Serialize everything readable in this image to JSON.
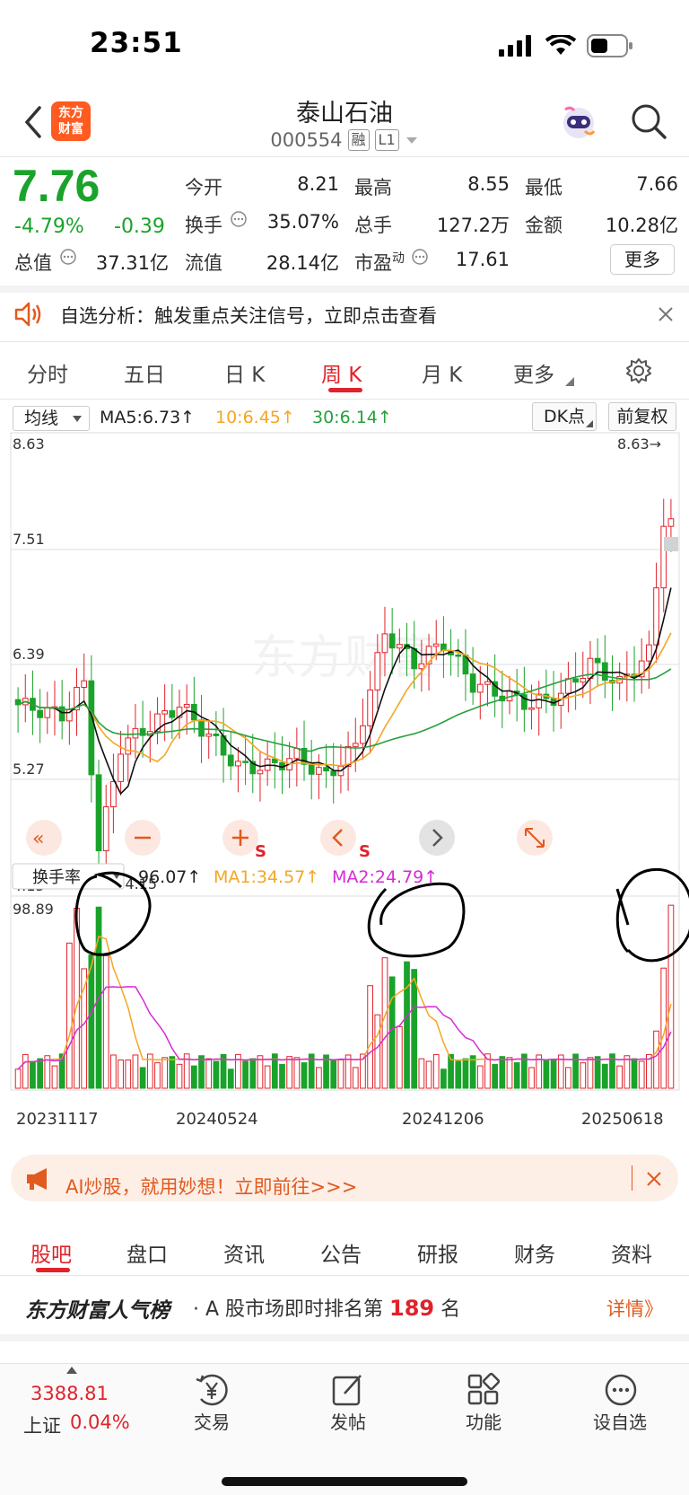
{
  "status": {
    "time": "23:51"
  },
  "header": {
    "title": "泰山石油",
    "code": "000554",
    "tag1": "融",
    "tag2": "L1",
    "logo_line1": "东方",
    "logo_line2": "财富"
  },
  "quote": {
    "price": "7.76",
    "change_pct": "-4.79%",
    "change": "-0.39",
    "open_label": "今开",
    "open": "8.21",
    "high_label": "最高",
    "high": "8.55",
    "low_label": "最低",
    "low": "7.66",
    "turnover_label": "换手",
    "turnover": "35.07%",
    "volume_label": "总手",
    "volume": "127.2万",
    "amount_label": "金额",
    "amount": "10.28亿",
    "mcap_label": "总值",
    "mcap": "37.31亿",
    "float_label": "流值",
    "float": "28.14亿",
    "pe_label": "市盈",
    "pe_sup": "动",
    "pe": "17.61",
    "more": "更多"
  },
  "banner": {
    "text": "自选分析：触发重点关注信号，立即点击查看"
  },
  "period_tabs": [
    "分时",
    "五日",
    "日 K",
    "周 K",
    "月 K",
    "更多"
  ],
  "ma": {
    "select": "均线",
    "ma5": "MA5:6.73↑",
    "ma10": "10:6.45↑",
    "ma30": "30:6.14↑",
    "dk": "DK点",
    "fq": "前复权"
  },
  "colors": {
    "up": "#e1222a",
    "down": "#1aa32a",
    "ma10": "#f5a623",
    "ma30": "#27a03c",
    "ma2": "#d62bd6"
  },
  "chart_data": [
    {
      "type": "candlestick",
      "y_ticks": [
        "8.63",
        "7.51",
        "6.39",
        "5.27",
        "4.15"
      ],
      "ylim": [
        4.15,
        8.63
      ],
      "max_label": "8.63→",
      "min_label": "←4.15",
      "tool_s1": "S",
      "tool_s2": "S"
    },
    {
      "type": "bar",
      "indicator": "换手率",
      "current": "96.07↑",
      "ma1": "MA1:34.57↑",
      "ma2": "MA2:24.79↑",
      "y_max_label": "98.89",
      "x_labels": [
        "20231117",
        "20240524",
        "20241206",
        "20250618"
      ]
    }
  ],
  "ai_banner": {
    "text": "AI炒股，就用妙想！立即前往>>>"
  },
  "bottom_tabs": [
    "股吧",
    "盘口",
    "资讯",
    "公告",
    "研报",
    "财务",
    "资料"
  ],
  "rank": {
    "brand": "东方财富人气榜",
    "text_pre": "· A 股市场即时排名第",
    "num": "189",
    "text_post": "名",
    "detail": "详情》"
  },
  "nav": {
    "index_value": "3388.81",
    "index_name": "上证",
    "index_change": "0.04%",
    "items": [
      "交易",
      "发帖",
      "功能",
      "设自选"
    ]
  }
}
